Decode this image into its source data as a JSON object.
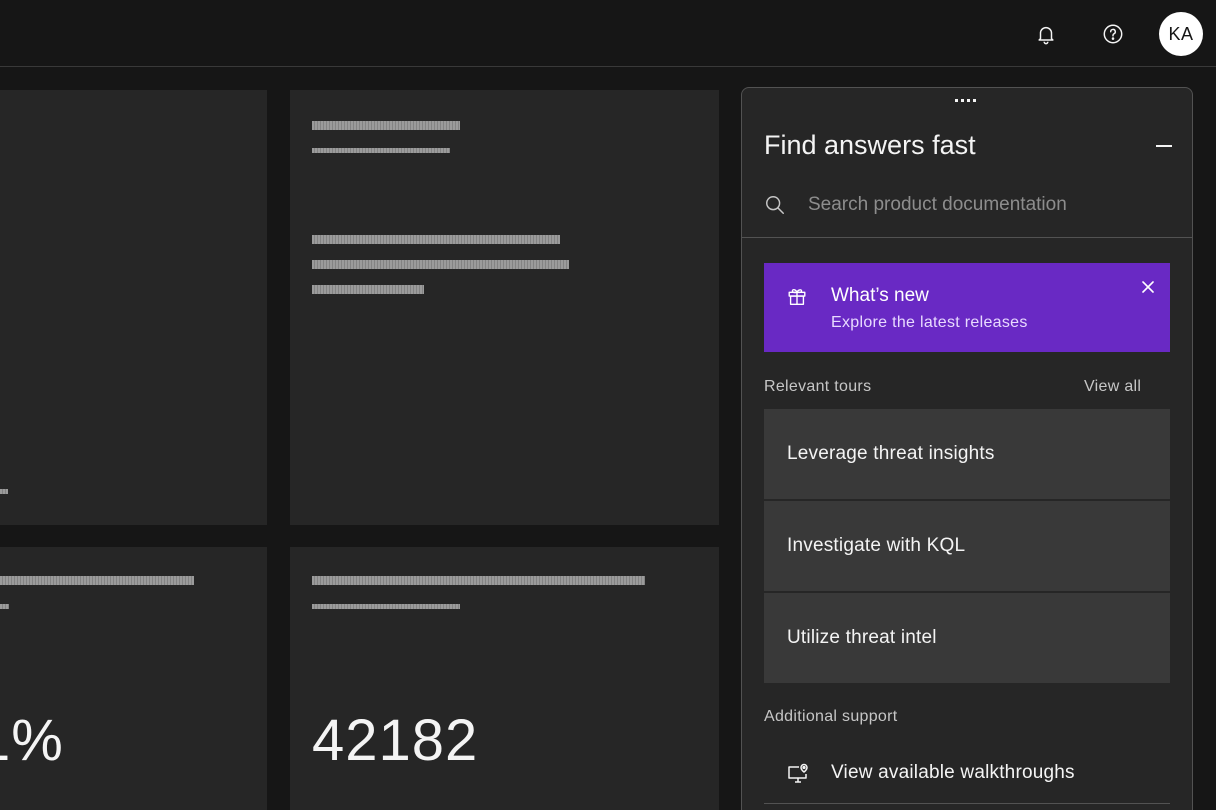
{
  "header": {
    "notifications_icon": "bell-icon",
    "help_icon": "help-icon",
    "avatar_initials": "KA"
  },
  "dashboard": {
    "tile_bottom_left_value": "1%",
    "tile_bottom_right_value": "42182"
  },
  "help_panel": {
    "title": "Find answers fast",
    "search": {
      "placeholder": "Search product documentation",
      "value": ""
    },
    "whats_new": {
      "title": "What’s new",
      "subtitle": "Explore the latest releases",
      "background_color": "#6929c4"
    },
    "relevant_tours": {
      "label": "Relevant tours",
      "view_all": "View all",
      "items": [
        {
          "label": "Leverage threat insights"
        },
        {
          "label": "Investigate with KQL"
        },
        {
          "label": "Utilize threat intel"
        }
      ]
    },
    "additional_support": {
      "label": "Additional support",
      "items": [
        {
          "label": "View available walkthroughs",
          "icon": "walkthrough-icon"
        }
      ]
    }
  }
}
